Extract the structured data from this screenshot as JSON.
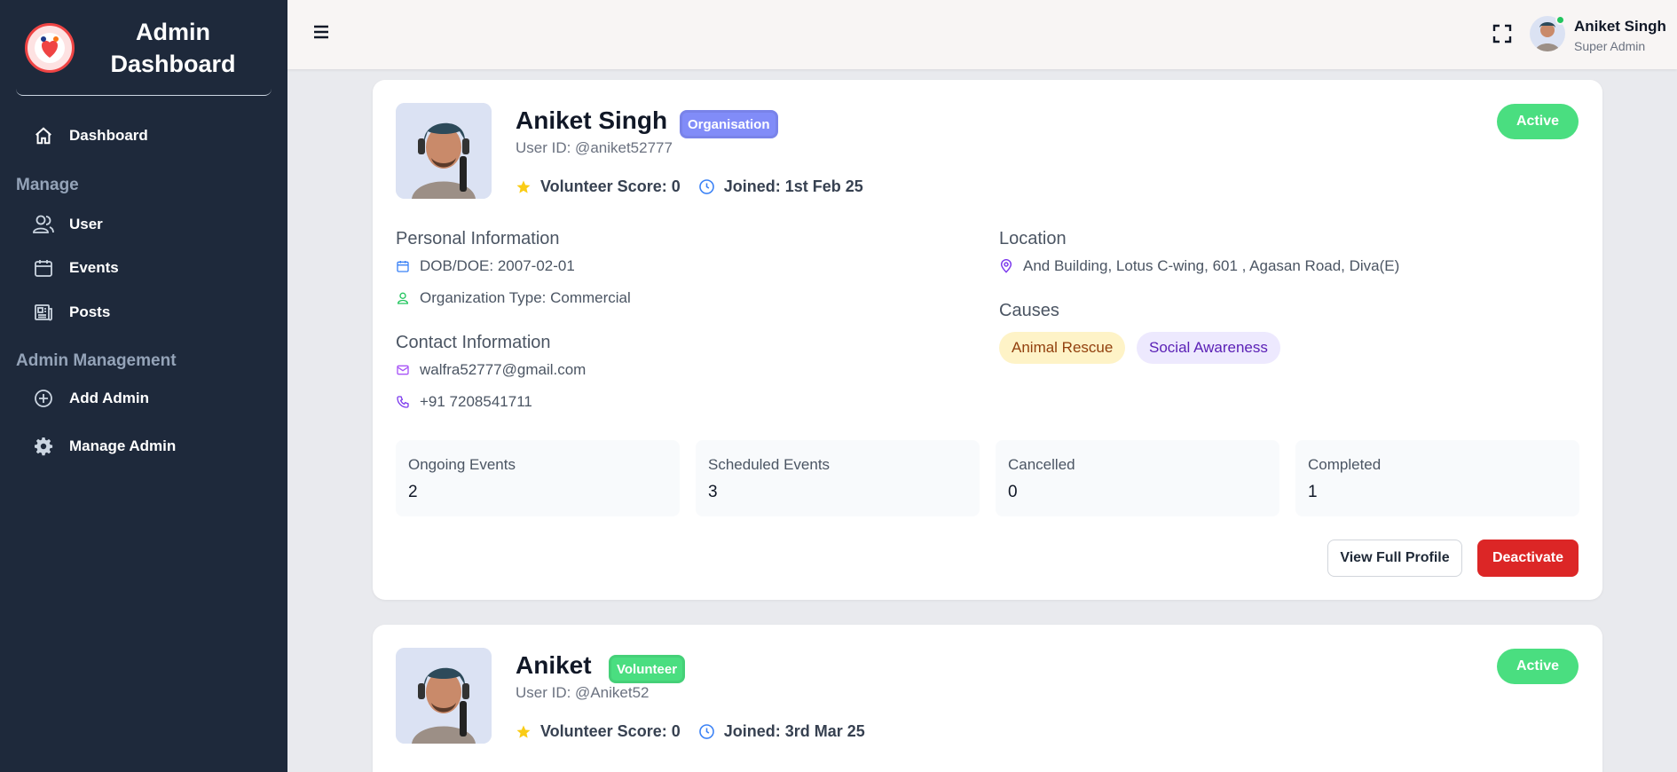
{
  "sidebar": {
    "title": "Admin Dashboard",
    "dashboard_label": "Dashboard",
    "manage_heading": "Manage",
    "manage_items": [
      "User",
      "Events",
      "Posts"
    ],
    "admin_heading": "Admin Management",
    "admin_items": [
      "Add Admin",
      "Manage Admin"
    ]
  },
  "header": {
    "user_name": "Aniket Singh",
    "user_role": "Super Admin",
    "online_color": "#22c55e"
  },
  "cards": [
    {
      "name": "Aniket Singh",
      "type": "Organisation",
      "type_color": "#818cf8",
      "user_id": "User ID: @aniket52777",
      "score": "Volunteer Score: 0",
      "joined": "Joined: 1st Feb 25",
      "status": "Active",
      "personal_title": "Personal Information",
      "dob": "DOB/DOE: 2007-02-01",
      "org_type": "Organization Type: Commercial",
      "contact_title": "Contact Information",
      "email": "walfra52777@gmail.com",
      "phone": "+91 7208541711",
      "location_title": "Location",
      "location": "And Building, Lotus C-wing, 601 , Agasan Road, Diva(E)",
      "causes_title": "Causes",
      "causes": [
        "Animal Rescue",
        "Social Awareness"
      ],
      "stats": [
        {
          "label": "Ongoing Events",
          "value": "2"
        },
        {
          "label": "Scheduled Events",
          "value": "3"
        },
        {
          "label": "Cancelled",
          "value": "0"
        },
        {
          "label": "Completed",
          "value": "1"
        }
      ],
      "view_profile_label": "View Full Profile",
      "deactivate_label": "Deactivate"
    },
    {
      "name": "Aniket",
      "type": "Volunteer",
      "type_color": "#4ade80",
      "user_id": "User ID: @Aniket52",
      "score": "Volunteer Score: 0",
      "joined": "Joined: 3rd Mar 25",
      "status": "Active"
    }
  ],
  "colors": {
    "sidebar_bg": "#1e293b",
    "active_green": "#4ade80",
    "deactivate_red": "#dc2626",
    "star_yellow": "#facc15"
  }
}
